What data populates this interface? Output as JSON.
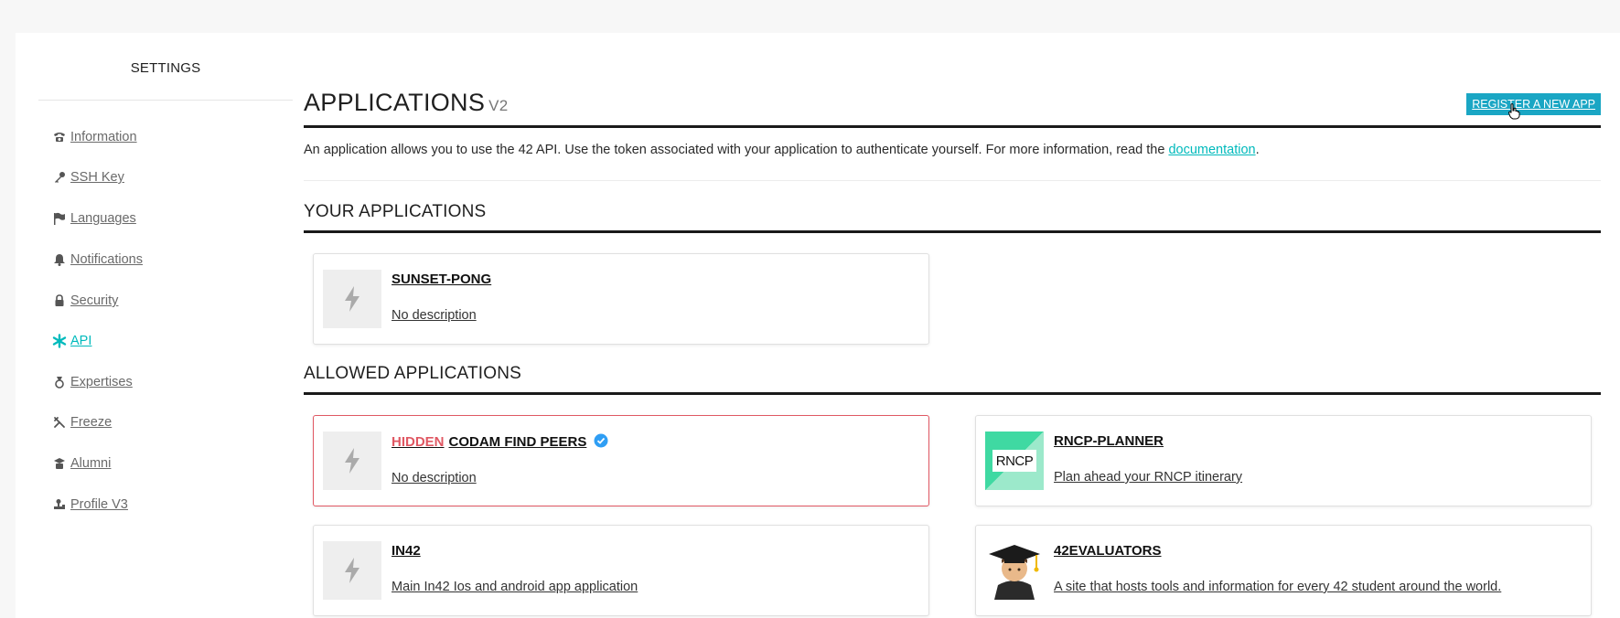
{
  "sidebar": {
    "title": "SETTINGS",
    "items": [
      {
        "label": "Information",
        "icon": "phone-icon"
      },
      {
        "label": "SSH Key",
        "icon": "key-icon"
      },
      {
        "label": "Languages",
        "icon": "flag-icon"
      },
      {
        "label": "Notifications",
        "icon": "bell-icon"
      },
      {
        "label": "Security",
        "icon": "lock-icon"
      },
      {
        "label": "API",
        "icon": "asterisk-icon",
        "active": true
      },
      {
        "label": "Expertises",
        "icon": "medal-icon"
      },
      {
        "label": "Freeze",
        "icon": "snowflake-icon"
      },
      {
        "label": "Alumni",
        "icon": "graduate-icon"
      },
      {
        "label": "Profile V3",
        "icon": "stamp-icon"
      }
    ]
  },
  "header": {
    "title": "APPLICATIONS",
    "version": "V2",
    "register_label": "REGISTER A NEW APP"
  },
  "intro": {
    "text": "An application allows you to use the 42 API. Use the token associated with your application to authenticate yourself. For more information, read the ",
    "link": "documentation",
    "end": "."
  },
  "your_apps": {
    "title": "YOUR APPLICATIONS",
    "apps": [
      {
        "name": "SUNSET-PONG",
        "description": "No description"
      }
    ]
  },
  "allowed_apps": {
    "title": "ALLOWED APPLICATIONS",
    "apps": [
      {
        "hidden_tag": "HIDDEN",
        "name": "CODAM FIND PEERS",
        "description": "No description",
        "verified": true
      },
      {
        "name": "RNCP-PLANNER",
        "description": "Plan ahead your RNCP itinerary",
        "logo_text": "RNCP"
      },
      {
        "name": "IN42",
        "description": "Main In42 Ios and android app application"
      },
      {
        "name": "42EVALUATORS",
        "description": "A site that hosts tools and information for every 42 student around the world."
      }
    ]
  },
  "colors": {
    "accent": "#00babc",
    "button": "#1aa6c4",
    "hidden": "#e05863",
    "verified": "#2f9ef4"
  }
}
